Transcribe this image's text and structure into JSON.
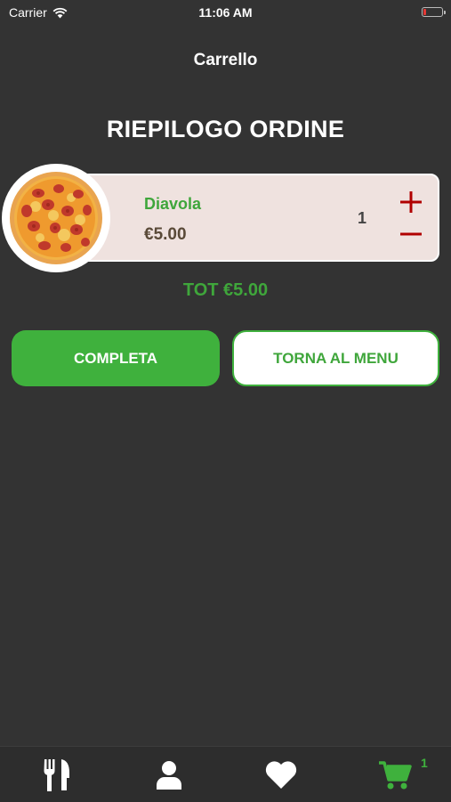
{
  "status_bar": {
    "carrier": "Carrier",
    "time": "11:06 AM",
    "battery_level": 0.15
  },
  "nav": {
    "title": "Carrello"
  },
  "summary": {
    "title": "RIEPILOGO ORDINE"
  },
  "cart": {
    "items": [
      {
        "name": "Diavola",
        "price": "€5.00",
        "quantity": "1",
        "image_icon": "pizza-image"
      }
    ],
    "total": "TOT €5.00"
  },
  "actions": {
    "complete_label": "COMPLETA",
    "back_label": "TORNA AL MENU"
  },
  "tab_bar": {
    "tabs": [
      {
        "icon": "fork-knife-icon",
        "active": false
      },
      {
        "icon": "user-icon",
        "active": false
      },
      {
        "icon": "heart-icon",
        "active": false
      },
      {
        "icon": "cart-icon",
        "active": true
      }
    ],
    "cart_badge": "1"
  },
  "colors": {
    "background": "#333333",
    "accent_green": "#3fb13d",
    "card": "#efe2df",
    "control_red": "#b00000"
  }
}
